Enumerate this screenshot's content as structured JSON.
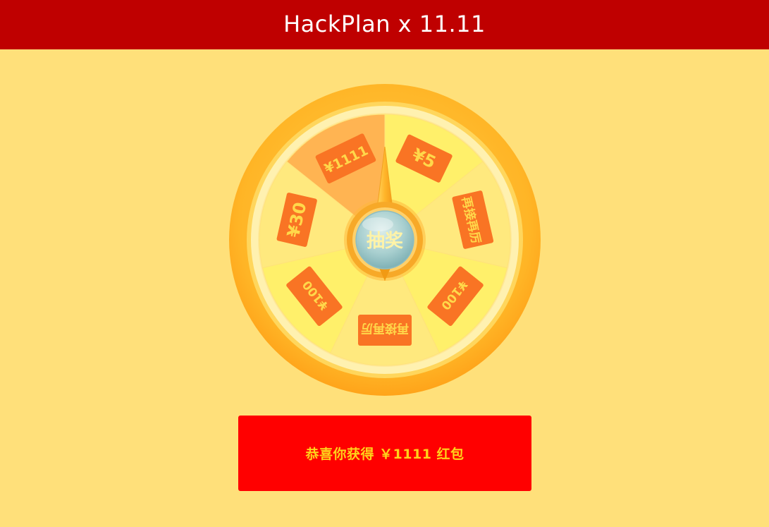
{
  "header": {
    "title": "HackPlan x 11.11"
  },
  "wheel": {
    "draw_button_label": "抽奖",
    "prizes": [
      {
        "label": "¥5"
      },
      {
        "label": "再接再厉"
      },
      {
        "label": "¥100"
      },
      {
        "label": "再接再厉"
      },
      {
        "label": "¥100"
      },
      {
        "label": "¥30"
      },
      {
        "label": "¥1111"
      }
    ],
    "highlighted_prize": "¥1111"
  },
  "result": {
    "text": "恭喜你获得 ￥1111 红包"
  },
  "colors": {
    "header_bg": "#bf0000",
    "page_bg": "#ffe07a",
    "result_bg": "#ff0000",
    "result_text": "#ffd21a",
    "prize_tag": "#f97424",
    "prize_text": "#ffd84a"
  }
}
